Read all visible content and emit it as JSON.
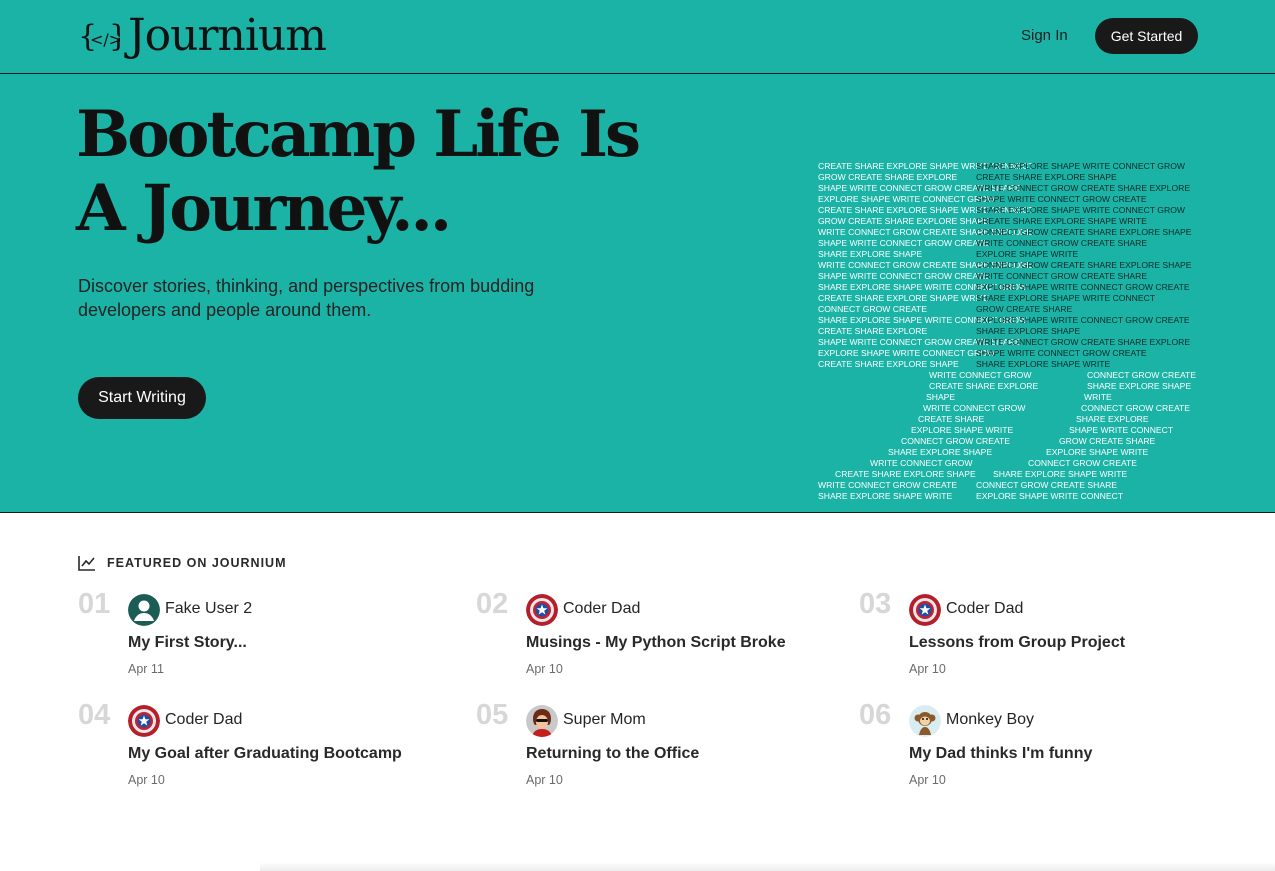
{
  "header": {
    "logo_text": "Journium",
    "signin_label": "Sign In",
    "get_started_label": "Get Started"
  },
  "hero": {
    "title": "Bootcamp Life Is A Journey...",
    "subtitle": "Discover stories, thinking, and perspectives from budding developers and people around them.",
    "cta_label": "Start Writing",
    "word_art_words": [
      "CREATE",
      "SHARE",
      "EXPLORE",
      "SHAPE",
      "WRITE",
      "CONNECT",
      "GROW"
    ]
  },
  "featured": {
    "heading": "FEATURED ON JOURNIUM",
    "items": [
      {
        "num": "01",
        "author": "Fake User 2",
        "avatar": "default-user-avatar",
        "title": "My First Story...",
        "date": "Apr 11"
      },
      {
        "num": "02",
        "author": "Coder Dad",
        "avatar": "captain-shield-avatar",
        "title": "Musings - My Python Script Broke",
        "date": "Apr 10"
      },
      {
        "num": "03",
        "author": "Coder Dad",
        "avatar": "captain-shield-avatar",
        "title": "Lessons from Group Project",
        "date": "Apr 10"
      },
      {
        "num": "04",
        "author": "Coder Dad",
        "avatar": "captain-shield-avatar",
        "title": "My Goal after Graduating Bootcamp",
        "date": "Apr 10"
      },
      {
        "num": "05",
        "author": "Super Mom",
        "avatar": "super-mom-avatar",
        "title": "Returning to the Office",
        "date": "Apr 10"
      },
      {
        "num": "06",
        "author": "Monkey Boy",
        "avatar": "monkey-avatar",
        "title": "My Dad thinks I'm funny",
        "date": "Apr 10"
      }
    ]
  },
  "colors": {
    "brand_teal": "#1ab3a6",
    "dark_button": "#191919",
    "number_gray": "#d7d7d7"
  }
}
